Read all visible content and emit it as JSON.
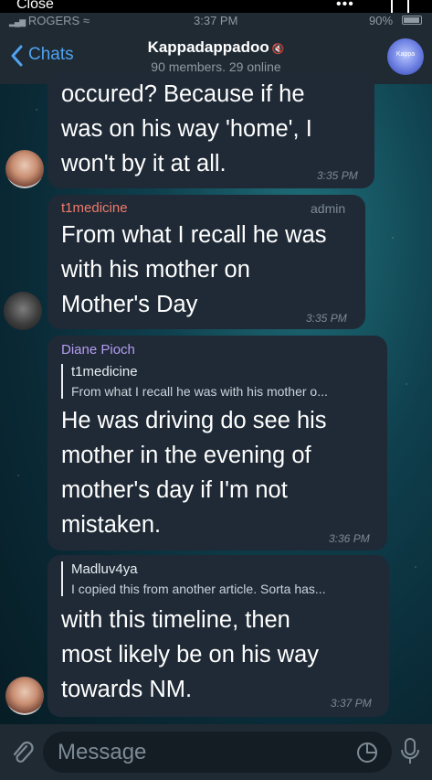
{
  "top": {
    "close_label": "Close",
    "dots": "•••"
  },
  "status_bar": {
    "carrier": "ROGERS",
    "time": "3:37 PM",
    "battery": "90%"
  },
  "header": {
    "back_label": "Chats",
    "title": "Kappadappadoo",
    "subtitle": "90 members, 29 online",
    "avatar_text": "Kappa"
  },
  "messages": [
    {
      "text_lines": [
        "occured? Because if he",
        "was on his way 'home', I",
        "won't by it at all."
      ],
      "time": "3:35 PM"
    },
    {
      "sender": "t1medicine",
      "sender_color": "#f07a6a",
      "badge": "admin",
      "text_lines": [
        "From what I recall he was",
        "with his mother on",
        "Mother's Day"
      ],
      "time": "3:35 PM"
    },
    {
      "sender": "Diane Pioch",
      "sender_color": "#b59cf2",
      "reply_name": "t1medicine",
      "reply_text": "From what I recall he was with his mother o...",
      "text_lines": [
        "He was driving do see his",
        "mother in the evening of",
        "mother's day if I'm not",
        "mistaken."
      ],
      "time": "3:36 PM"
    },
    {
      "reply_name": "Madluv4ya",
      "reply_text": "I copied this from another article. Sorta has...",
      "text_lines": [
        "with this timeline, then",
        "most likely be on his way",
        "towards NM."
      ],
      "time": "3:37 PM"
    }
  ],
  "input": {
    "placeholder": "Message"
  }
}
